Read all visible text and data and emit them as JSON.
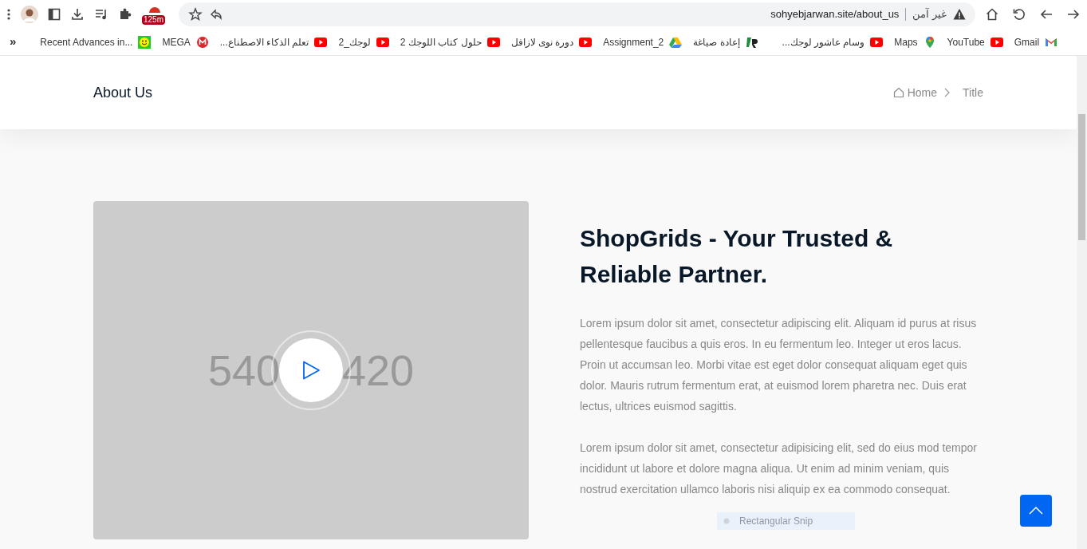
{
  "browser": {
    "security_label": "غير آمن",
    "url": "sohyebjarwan.site/about_us",
    "extension_badge": "125m",
    "overflow": "»",
    "bookmarks": [
      {
        "label": "Recent Advances in...",
        "kind": "smiley"
      },
      {
        "label": "MEGA",
        "kind": "mega"
      },
      {
        "label": "تعلم الذكاء الاصطناع...",
        "kind": "youtube"
      },
      {
        "label": "لوجك_2",
        "kind": "youtube"
      },
      {
        "label": "حلول كتاب اللوجك 2",
        "kind": "youtube"
      },
      {
        "label": "دورة نوى لازافل",
        "kind": "youtube"
      },
      {
        "label": "Assignment_2",
        "kind": "drive"
      },
      {
        "label": "إعادة صياغة",
        "kind": "rlogo"
      },
      {
        "label": "وسام عاشور لوجك...",
        "kind": "youtube"
      },
      {
        "label": "Maps",
        "kind": "maps"
      },
      {
        "label": "YouTube",
        "kind": "youtube"
      },
      {
        "label": "Gmail",
        "kind": "gmail"
      }
    ]
  },
  "page_header": {
    "title": "About Us",
    "breadcrumb": [
      "Home",
      "Title"
    ]
  },
  "about": {
    "video": {
      "left_text": "540",
      "right_text": "420"
    },
    "heading": "ShopGrids - Your Trusted & Reliable Partner.",
    "paragraphs": [
      "Lorem ipsum dolor sit amet, consectetur adipiscing elit. Aliquam id purus at risus pellentesque faucibus a quis eros. In eu fermentum leo. Integer ut eros lacus. Proin ut accumsan leo. Morbi vitae est eget dolor consequat aliquam eget quis dolor. Mauris rutrum fermentum erat, at euismod lorem pharetra nec. Duis erat lectus, ultrices euismod sagittis.",
      "Lorem ipsum dolor sit amet, consectetur adipisicing elit, sed do eius mod tempor incididunt ut labore et dolore magna aliqua. Ut enim ad minim veniam, quis nostrud exercitation ullamco laboris nisi aliquip ex ea commodo consequat."
    ]
  },
  "snip_hint": "Rectangular Snip"
}
